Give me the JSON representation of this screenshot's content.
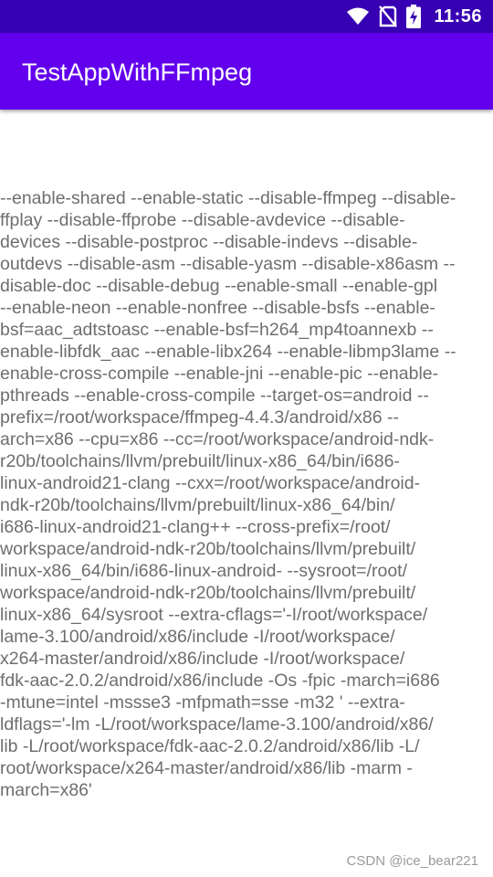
{
  "status_bar": {
    "time": "11:56",
    "icons": [
      "wifi-icon",
      "no-sim-icon",
      "battery-charging-icon"
    ]
  },
  "app_bar": {
    "title": "TestAppWithFFmpeg"
  },
  "content": {
    "config_lines": [
      "--enable-shared --enable-static --disable-ffmpeg --disable-",
      "ffplay --disable-ffprobe --disable-avdevice --disable-",
      "devices --disable-postproc --disable-indevs --disable-",
      "outdevs --disable-asm --disable-yasm --disable-x86asm --",
      "disable-doc --disable-debug --enable-small --enable-gpl",
      "--enable-neon --enable-nonfree --disable-bsfs --enable-",
      "bsf=aac_adtstoasc --enable-bsf=h264_mp4toannexb --",
      "enable-libfdk_aac --enable-libx264 --enable-libmp3lame --",
      "enable-cross-compile --enable-jni --enable-pic --enable-",
      "pthreads --enable-cross-compile --target-os=android --",
      "prefix=/root/workspace/ffmpeg-4.4.3/android/x86 --",
      "arch=x86 --cpu=x86 --cc=/root/workspace/android-ndk-",
      "r20b/toolchains/llvm/prebuilt/linux-x86_64/bin/i686-",
      "linux-android21-clang --cxx=/root/workspace/android-",
      "ndk-r20b/toolchains/llvm/prebuilt/linux-x86_64/bin/",
      "i686-linux-android21-clang++ --cross-prefix=/root/",
      "workspace/android-ndk-r20b/toolchains/llvm/prebuilt/",
      "linux-x86_64/bin/i686-linux-android- --sysroot=/root/",
      "workspace/android-ndk-r20b/toolchains/llvm/prebuilt/",
      "linux-x86_64/sysroot --extra-cflags='-I/root/workspace/",
      "lame-3.100/android/x86/include -I/root/workspace/",
      "x264-master/android/x86/include -I/root/workspace/",
      "fdk-aac-2.0.2/android/x86/include -Os -fpic -march=i686",
      "-mtune=intel -mssse3 -mfpmath=sse -m32 ' --extra-",
      "ldflags='-lm -L/root/workspace/lame-3.100/android/x86/",
      "lib -L/root/workspace/fdk-aac-2.0.2/android/x86/lib -L/",
      "root/workspace/x264-master/android/x86/lib -marm -",
      "march=x86'"
    ]
  },
  "watermark": "CSDN @ice_bear221",
  "colors": {
    "status_bar": "#3700b3",
    "app_bar": "#6200ee",
    "text": "#6e6e6e"
  }
}
